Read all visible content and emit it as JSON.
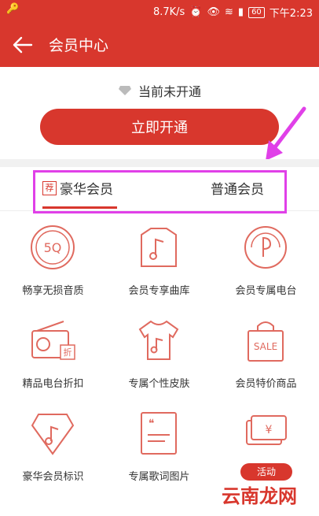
{
  "status_bar": {
    "speed": "8.7K/s",
    "battery": "60",
    "time": "下午2:23"
  },
  "header": {
    "title": "会员中心"
  },
  "membership": {
    "status": "当前未开通",
    "open_label": "立即开通"
  },
  "tabs": {
    "luxury_tag": "荐",
    "luxury": "豪华会员",
    "normal": "普通会员"
  },
  "benefits": [
    {
      "label": "畅享无损音质",
      "badge": "5Q"
    },
    {
      "label": "会员专享曲库",
      "badge": ""
    },
    {
      "label": "会员专属电台",
      "badge": ""
    },
    {
      "label": "精品电台折扣",
      "badge": "折"
    },
    {
      "label": "专属个性皮肤",
      "badge": ""
    },
    {
      "label": "会员特价商品",
      "badge": "SALE"
    },
    {
      "label": "豪华会员标识",
      "badge": ""
    },
    {
      "label": "专属歌词图片",
      "badge": ""
    },
    {
      "label": "",
      "badge": "¥"
    }
  ],
  "activity_badge": "活动",
  "watermark": "云南龙网"
}
